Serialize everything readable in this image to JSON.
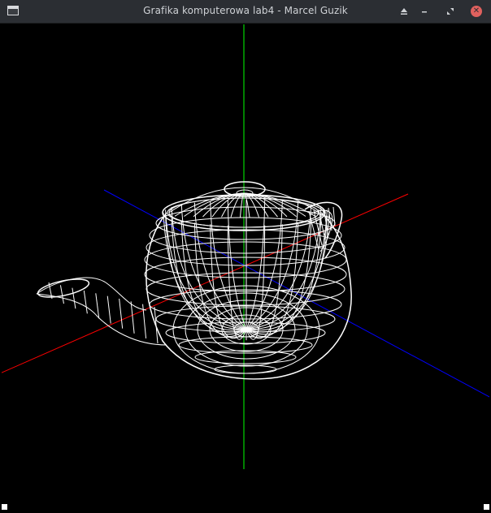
{
  "window": {
    "title": "Grafika komputerowa lab4 - Marcel Guzik",
    "controls": {
      "shade_icon": "eject-triangle-icon",
      "minimize_icon": "minimize-icon",
      "maximize_icon": "maximize-icon",
      "close_icon": "close-icon"
    }
  },
  "scene": {
    "background": "#000000",
    "object": "teapot",
    "render_mode": "wireframe",
    "wire_color": "#ffffff",
    "axes": {
      "x_color": "#ff0000",
      "y_color": "#00ff00",
      "z_color": "#0000ff"
    }
  }
}
